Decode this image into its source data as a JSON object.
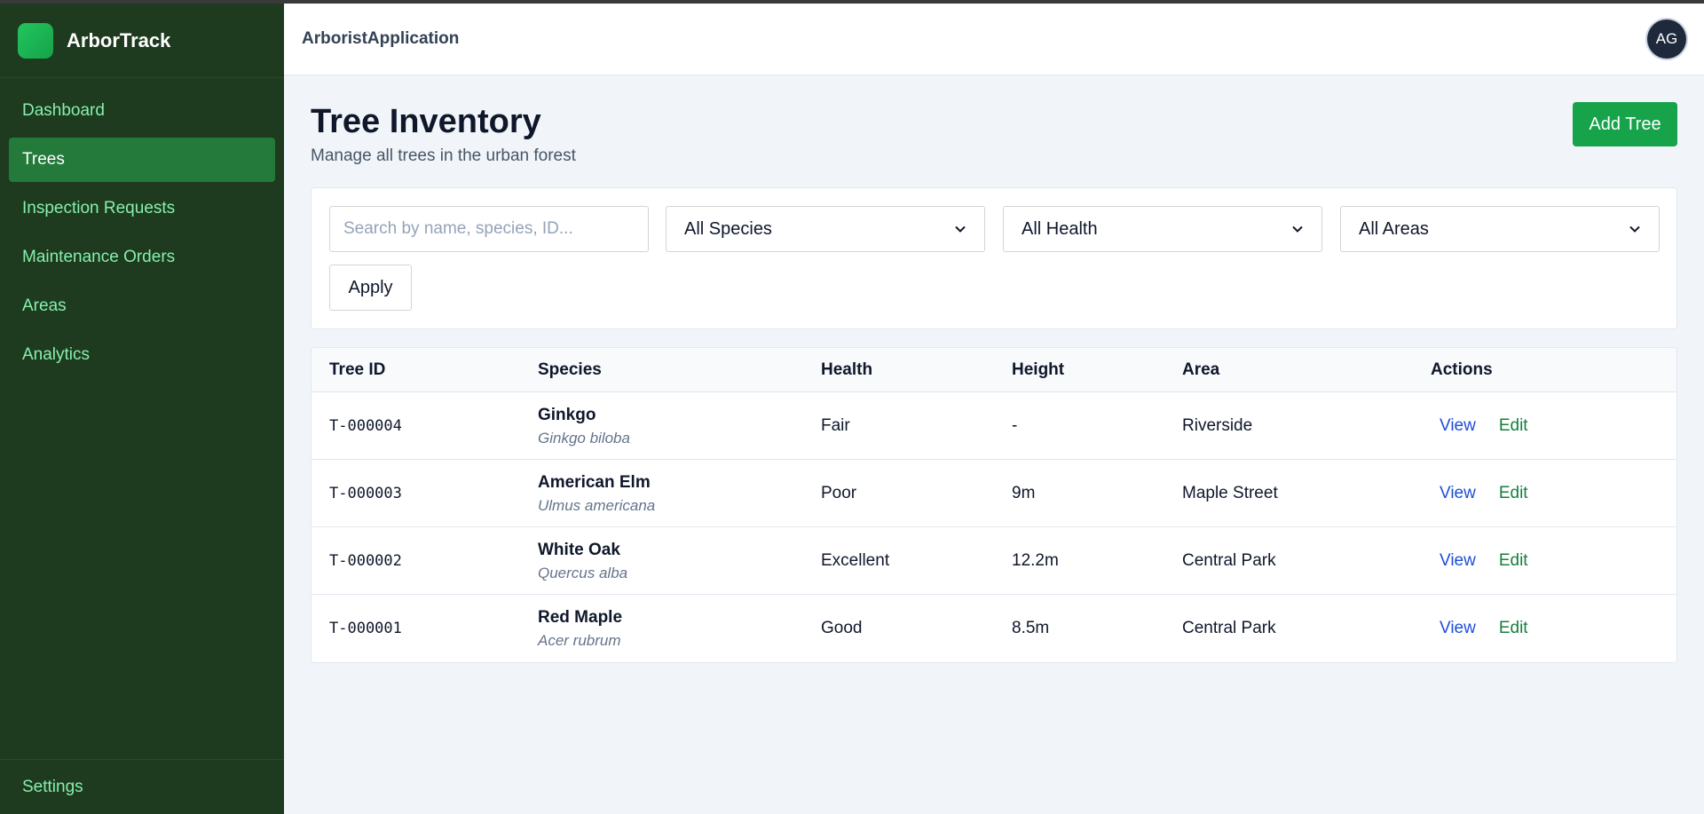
{
  "brand": {
    "name": "ArborTrack",
    "accent": "#16a34a"
  },
  "sidebar": {
    "items": [
      {
        "label": "Dashboard",
        "active": false
      },
      {
        "label": "Trees",
        "active": true
      },
      {
        "label": "Inspection Requests",
        "active": false
      },
      {
        "label": "Maintenance Orders",
        "active": false
      },
      {
        "label": "Areas",
        "active": false
      },
      {
        "label": "Analytics",
        "active": false
      }
    ],
    "settings_label": "Settings"
  },
  "header": {
    "app_name": "ArboristApplication",
    "avatar_initials": "AG"
  },
  "page": {
    "title": "Tree Inventory",
    "subtitle": "Manage all trees in the urban forest",
    "add_button": "Add Tree"
  },
  "filters": {
    "search_placeholder": "Search by name, species, ID...",
    "species": "All Species",
    "health": "All Health",
    "area": "All Areas",
    "apply_label": "Apply"
  },
  "table": {
    "columns": [
      "Tree ID",
      "Species",
      "Health",
      "Height",
      "Area",
      "Actions"
    ],
    "view_label": "View",
    "edit_label": "Edit",
    "rows": [
      {
        "id": "T-000004",
        "species": "Ginkgo",
        "scientific": "Ginkgo biloba",
        "health": "Fair",
        "height": "-",
        "area": "Riverside"
      },
      {
        "id": "T-000003",
        "species": "American Elm",
        "scientific": "Ulmus americana",
        "health": "Poor",
        "height": "9m",
        "area": "Maple Street"
      },
      {
        "id": "T-000002",
        "species": "White Oak",
        "scientific": "Quercus alba",
        "health": "Excellent",
        "height": "12.2m",
        "area": "Central Park"
      },
      {
        "id": "T-000001",
        "species": "Red Maple",
        "scientific": "Acer rubrum",
        "health": "Good",
        "height": "8.5m",
        "area": "Central Park"
      }
    ]
  }
}
